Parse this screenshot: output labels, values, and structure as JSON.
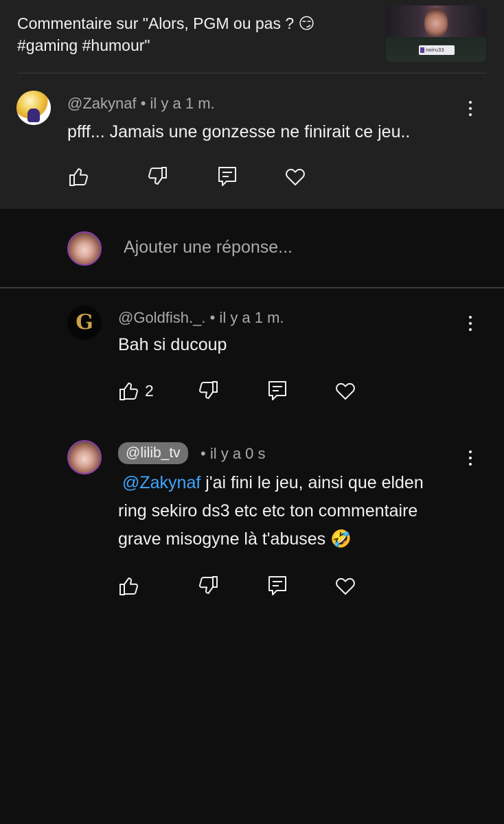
{
  "header": {
    "title": "Commentaire sur \"Alors, PGM ou pas ? 😏 #gaming #humour\"",
    "thumbnail_tag": "noiru33"
  },
  "parent_comment": {
    "author": "@Zakynaf",
    "time": " • il y a 1 m.",
    "text": "pfff... Jamais une gonzesse ne finirait ce jeu.."
  },
  "reply_input": {
    "placeholder": "Ajouter une réponse..."
  },
  "replies": [
    {
      "author": "@Goldfish._.",
      "time": " • il y a 1 m.",
      "text": "Bah si ducoup",
      "like_count": "2",
      "avatar_letter": "G"
    },
    {
      "author": "@lilib_tv",
      "time": " • il y a 0 s",
      "mention": "@Zakynaf",
      "text_line1": " j'ai fini le jeu, ainsi que elden",
      "text_line2": "ring sekiro ds3 etc etc ton commentaire",
      "text_line3": "grave misogyne là t'abuses 🤣"
    }
  ],
  "icons": {
    "like": "thumbs-up-icon",
    "dislike": "thumbs-down-icon",
    "reply": "comment-icon",
    "heart": "heart-icon",
    "more": "more-vert-icon"
  },
  "colors": {
    "background": "#0f0f0f",
    "panel": "#212121",
    "text": "#f1f1f1",
    "secondary": "#aaaaaa",
    "mention": "#3ea6ff"
  }
}
